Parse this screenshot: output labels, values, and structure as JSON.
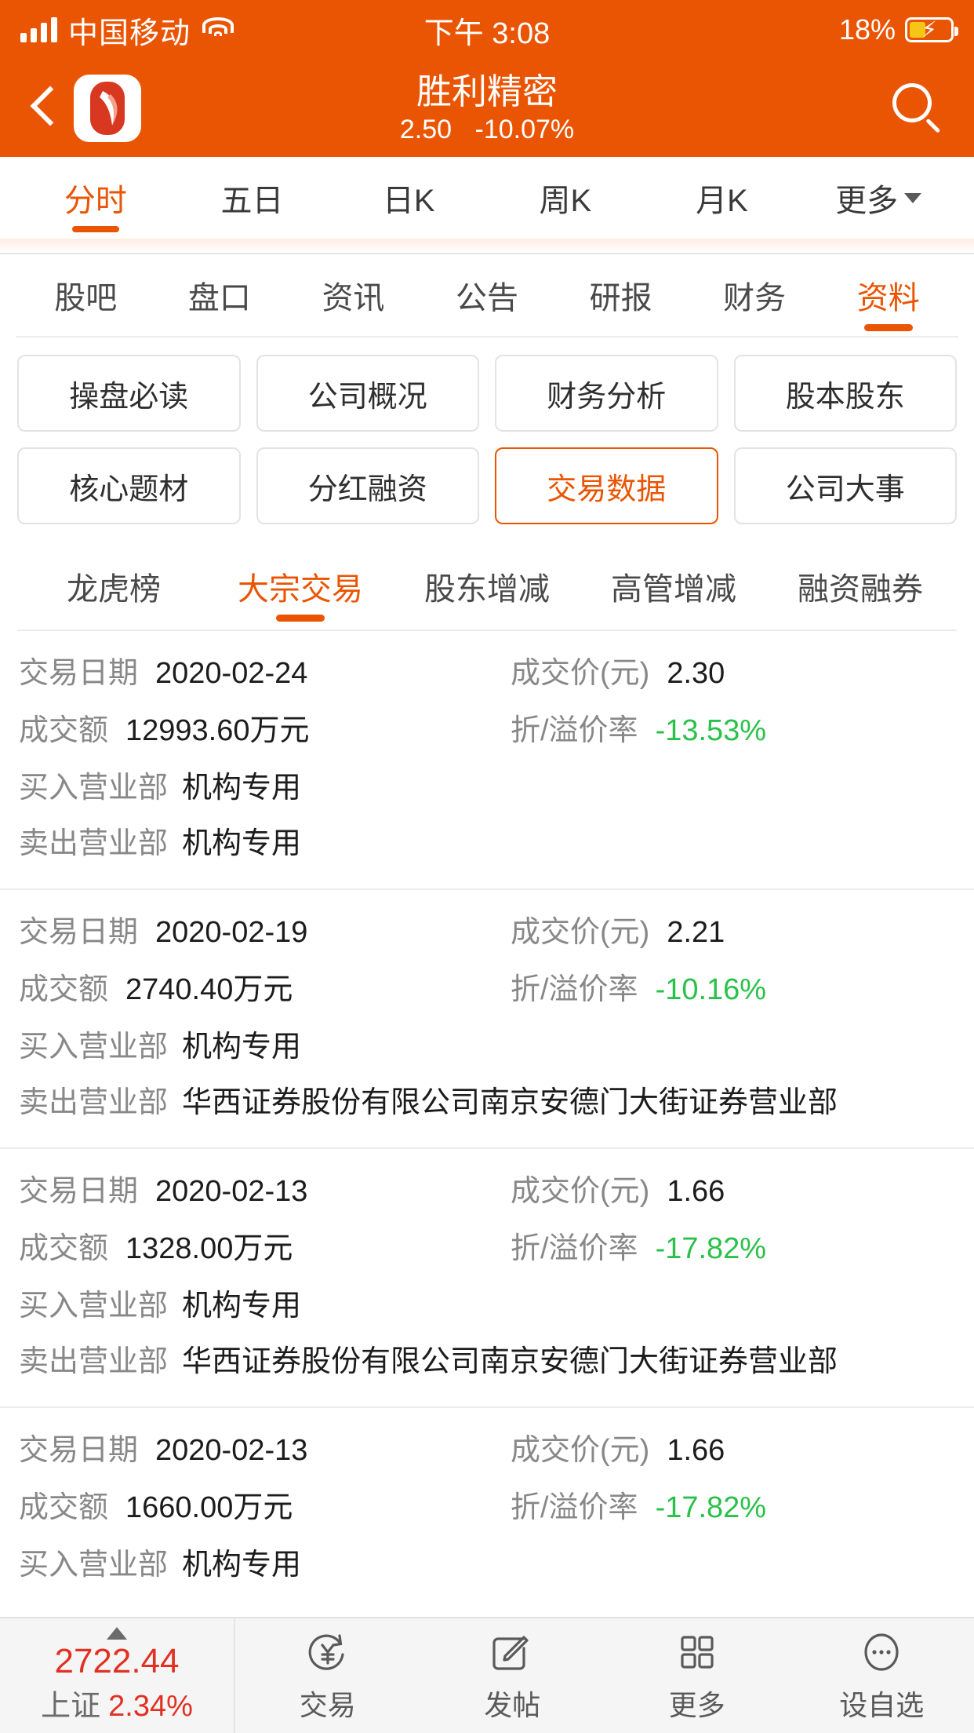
{
  "status_bar": {
    "carrier": "中国移动",
    "time": "下午 3:08",
    "battery_pct": "18%",
    "signal_icon": "signal-bars-icon",
    "wifi_icon": "wifi-icon",
    "battery_icon": "battery-charging-icon"
  },
  "header": {
    "back_icon": "back-chevron-icon",
    "app_logo": "app-logo-icon",
    "stock_name": "胜利精密",
    "price": "2.50",
    "change_pct": "-10.07%",
    "search_icon": "search-icon"
  },
  "chart_tabs": [
    {
      "label": "分时",
      "active": true
    },
    {
      "label": "五日",
      "active": false
    },
    {
      "label": "日K",
      "active": false
    },
    {
      "label": "周K",
      "active": false
    },
    {
      "label": "月K",
      "active": false
    },
    {
      "label": "更多",
      "active": false,
      "caret": true
    }
  ],
  "info_tabs": [
    {
      "label": "股吧",
      "active": false
    },
    {
      "label": "盘口",
      "active": false
    },
    {
      "label": "资讯",
      "active": false
    },
    {
      "label": "公告",
      "active": false
    },
    {
      "label": "研报",
      "active": false
    },
    {
      "label": "财务",
      "active": false
    },
    {
      "label": "资料",
      "active": true
    }
  ],
  "category_buttons": [
    {
      "label": "操盘必读",
      "active": false
    },
    {
      "label": "公司概况",
      "active": false
    },
    {
      "label": "财务分析",
      "active": false
    },
    {
      "label": "股本股东",
      "active": false
    },
    {
      "label": "核心题材",
      "active": false
    },
    {
      "label": "分红融资",
      "active": false
    },
    {
      "label": "交易数据",
      "active": true
    },
    {
      "label": "公司大事",
      "active": false
    }
  ],
  "sub_tabs": [
    {
      "label": "龙虎榜",
      "active": false
    },
    {
      "label": "大宗交易",
      "active": true
    },
    {
      "label": "股东增减",
      "active": false
    },
    {
      "label": "高管增减",
      "active": false
    },
    {
      "label": "融资融券",
      "active": false
    }
  ],
  "field_labels": {
    "date": "交易日期",
    "price": "成交价(元)",
    "amount": "成交额",
    "premium": "折/溢价率",
    "buyer": "买入营业部",
    "seller": "卖出营业部"
  },
  "records": [
    {
      "date": "2020-02-24",
      "price": "2.30",
      "amount": "12993.60万元",
      "premium": "-13.53%",
      "buyer": "机构专用",
      "seller": "机构专用",
      "clipped": false
    },
    {
      "date": "2020-02-19",
      "price": "2.21",
      "amount": "2740.40万元",
      "premium": "-10.16%",
      "buyer": "机构专用",
      "seller": "华西证券股份有限公司南京安德门大街证券营业部",
      "clipped": false
    },
    {
      "date": "2020-02-13",
      "price": "1.66",
      "amount": "1328.00万元",
      "premium": "-17.82%",
      "buyer": "机构专用",
      "seller": "华西证券股份有限公司南京安德门大街证券营业部",
      "clipped": false
    },
    {
      "date": "2020-02-13",
      "price": "1.66",
      "amount": "1660.00万元",
      "premium": "-17.82%",
      "buyer": "机构专用",
      "seller": "",
      "clipped": true
    }
  ],
  "bottom_bar": {
    "index_value": "2722.44",
    "index_name": "上证",
    "index_change": "2.34%",
    "trend_icon": "up-triangle-icon",
    "items": [
      {
        "label": "交易",
        "icon": "yen-exchange-icon"
      },
      {
        "label": "发帖",
        "icon": "compose-pencil-icon"
      },
      {
        "label": "更多",
        "icon": "grid-squares-icon"
      },
      {
        "label": "设自选",
        "icon": "more-ellipsis-circle-icon"
      }
    ]
  },
  "colors": {
    "brand_orange": "#ea5504",
    "down_green": "#2ac14a",
    "up_red": "#e03123"
  }
}
